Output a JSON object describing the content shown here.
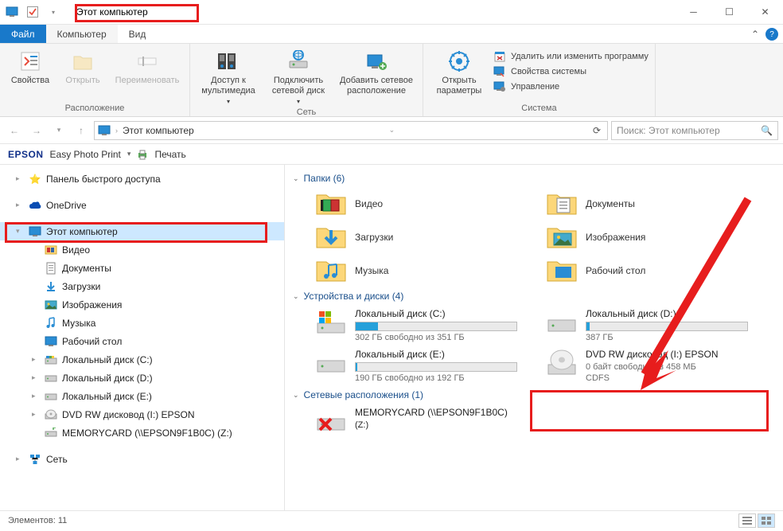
{
  "window": {
    "title": "Этот компьютер"
  },
  "tabs": {
    "file": "Файл",
    "computer": "Компьютер",
    "view": "Вид"
  },
  "ribbon": {
    "group1": {
      "properties": "Свойства",
      "open": "Открыть",
      "rename": "Переименовать",
      "label": "Расположение"
    },
    "group2": {
      "media": "Доступ к мультимедиа",
      "mapdrive": "Подключить сетевой диск",
      "addnet": "Добавить сетевое расположение",
      "label": "Сеть"
    },
    "group3": {
      "opensettings": "Открыть параметры",
      "uninstall": "Удалить или изменить программу",
      "sysprops": "Свойства системы",
      "manage": "Управление",
      "label": "Система"
    }
  },
  "address": {
    "location": "Этот компьютер"
  },
  "search": {
    "placeholder": "Поиск: Этот компьютер"
  },
  "epson": {
    "logo": "EPSON",
    "app": "Easy Photo Print",
    "print": "Печать"
  },
  "tree": {
    "quick": "Панель быстрого доступа",
    "onedrive": "OneDrive",
    "thispc": "Этот компьютер",
    "video": "Видео",
    "documents": "Документы",
    "downloads": "Загрузки",
    "pictures": "Изображения",
    "music": "Музыка",
    "desktop": "Рабочий стол",
    "diskc": "Локальный диск (C:)",
    "diskd": "Локальный диск (D:)",
    "diske": "Локальный диск (E:)",
    "dvd": "DVD RW дисковод (I:) EPSON",
    "memcard": "MEMORYCARD (\\\\EPSON9F1B0C) (Z:)",
    "network": "Сеть"
  },
  "content": {
    "folders_header": "Папки (6)",
    "devices_header": "Устройства и диски (4)",
    "netloc_header": "Сетевые расположения (1)",
    "folders": {
      "video": "Видео",
      "documents": "Документы",
      "downloads": "Загрузки",
      "pictures": "Изображения",
      "music": "Музыка",
      "desktop": "Рабочий стол"
    },
    "drives": {
      "c": {
        "name": "Локальный диск (C:)",
        "text": "302 ГБ свободно из 351 ГБ"
      },
      "d": {
        "name": "Локальный диск (D:)",
        "text": "387 ГБ"
      },
      "e": {
        "name": "Локальный диск (E:)",
        "text": "190 ГБ свободно из 192 ГБ"
      },
      "dvd": {
        "name": "DVD RW дисковод (I:) EPSON",
        "text": "0 байт свободно из 458 МБ",
        "fs": "CDFS"
      }
    },
    "netloc": {
      "name": "MEMORYCARD (\\\\EPSON9F1B0C)",
      "sub": "(Z:)"
    }
  },
  "status": {
    "count": "Элементов: 11"
  }
}
